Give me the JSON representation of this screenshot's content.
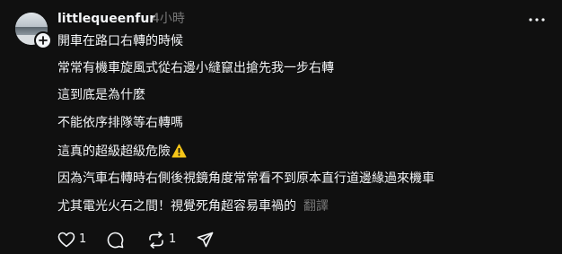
{
  "post": {
    "username": "littlequeenfur",
    "timestamp": "4小時",
    "lines": [
      "開車在路口右轉的時候",
      "常常有機車旋風式從右邊小縫竄出搶先我一步右轉",
      "這到底是為什麼",
      "不能依序排隊等右轉嗎",
      "這真的超級超級危險",
      "因為汽車右轉時右側後視鏡角度常常看不到原本直行道邊緣過來機車",
      "尤其電光火石之間！視覺死角超容易車禍的"
    ],
    "translate_label": "翻譯",
    "like_count": "1",
    "repost_count": "1"
  },
  "colors": {
    "background": "#101010",
    "text": "#f3f5f7",
    "secondary": "#777777",
    "warning": "#f5c518"
  },
  "icons": {
    "avatar": "avatar-photo",
    "follow": "plus-icon",
    "more": "more-horizontal-icon",
    "warning": "warning-icon",
    "like": "heart-icon",
    "reply": "comment-icon",
    "repost": "repost-icon",
    "share": "send-icon"
  }
}
